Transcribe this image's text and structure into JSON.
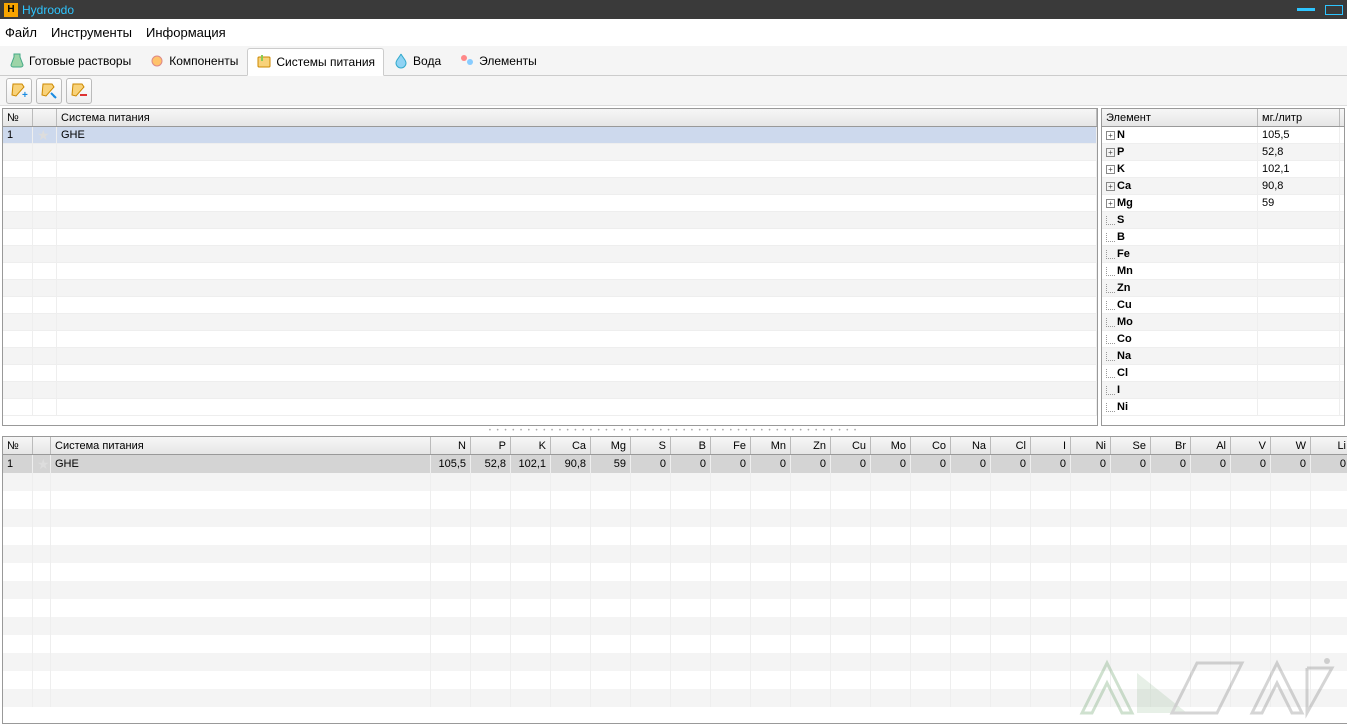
{
  "title": "Hydroodo",
  "title_icon_letter": "H",
  "menu": [
    "Файл",
    "Инструменты",
    "Информация"
  ],
  "tabs": [
    {
      "label": "Готовые растворы",
      "active": false
    },
    {
      "label": "Компоненты",
      "active": false
    },
    {
      "label": "Системы питания",
      "active": true
    },
    {
      "label": "Вода",
      "active": false
    },
    {
      "label": "Элементы",
      "active": false
    }
  ],
  "left_grid": {
    "headers": {
      "num": "№",
      "name": "Система питания"
    },
    "rows": [
      {
        "num": "1",
        "name": "GHE"
      }
    ]
  },
  "right_grid": {
    "headers": {
      "el": "Элемент",
      "val": "мг./литр"
    },
    "rows": [
      {
        "el": "N",
        "val": "105,5",
        "exp": true
      },
      {
        "el": "P",
        "val": "52,8",
        "exp": true
      },
      {
        "el": "K",
        "val": "102,1",
        "exp": true
      },
      {
        "el": "Ca",
        "val": "90,8",
        "exp": true
      },
      {
        "el": "Mg",
        "val": "59",
        "exp": true
      },
      {
        "el": "S",
        "val": "",
        "exp": false
      },
      {
        "el": "B",
        "val": "",
        "exp": false
      },
      {
        "el": "Fe",
        "val": "",
        "exp": false
      },
      {
        "el": "Mn",
        "val": "",
        "exp": false
      },
      {
        "el": "Zn",
        "val": "",
        "exp": false
      },
      {
        "el": "Cu",
        "val": "",
        "exp": false
      },
      {
        "el": "Mo",
        "val": "",
        "exp": false
      },
      {
        "el": "Co",
        "val": "",
        "exp": false
      },
      {
        "el": "Na",
        "val": "",
        "exp": false
      },
      {
        "el": "Cl",
        "val": "",
        "exp": false
      },
      {
        "el": "I",
        "val": "",
        "exp": false
      },
      {
        "el": "Ni",
        "val": "",
        "exp": false
      }
    ]
  },
  "bottom_grid": {
    "head_num": "№",
    "head_name": "Система питания",
    "cols": [
      "N",
      "P",
      "K",
      "Ca",
      "Mg",
      "S",
      "B",
      "Fe",
      "Mn",
      "Zn",
      "Cu",
      "Mo",
      "Co",
      "Na",
      "Cl",
      "I",
      "Ni",
      "Se",
      "Br",
      "Al",
      "V",
      "W",
      "Li"
    ],
    "row": {
      "num": "1",
      "name": "GHE",
      "vals": [
        "105,5",
        "52,8",
        "102,1",
        "90,8",
        "59",
        "0",
        "0",
        "0",
        "0",
        "0",
        "0",
        "0",
        "0",
        "0",
        "0",
        "0",
        "0",
        "0",
        "0",
        "0",
        "0",
        "0",
        "0"
      ]
    }
  }
}
